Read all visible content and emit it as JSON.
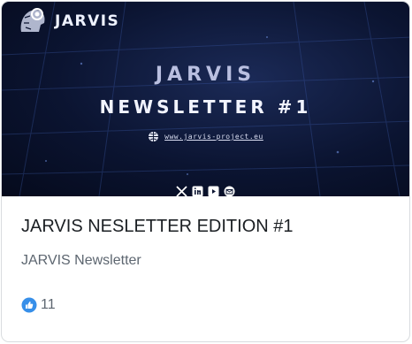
{
  "banner": {
    "logo_text": "JARVIS",
    "title_line1": "JARVIS",
    "title_line2": "NEWSLETTER #1",
    "url": "www.jarvis-project.eu",
    "socials": [
      "x-icon",
      "linkedin-icon",
      "youtube-icon",
      "email-icon"
    ]
  },
  "card": {
    "title": "JARVIS NESLETTER EDITION #1",
    "subtitle": "JARVIS Newsletter",
    "reaction_icon": "like-icon",
    "reaction_count": "11"
  },
  "colors": {
    "banner_dark": "#0b1431",
    "banner_accent": "#b9bfe0",
    "like_blue": "#378fe9"
  }
}
